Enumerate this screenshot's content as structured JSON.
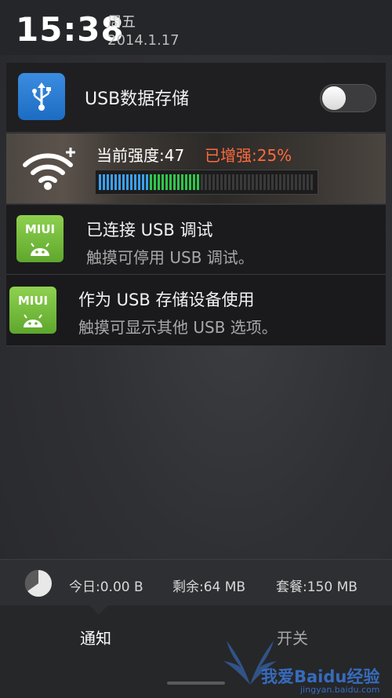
{
  "status": {
    "time": "15:38",
    "weekday": "周五",
    "date": "2014.1.17"
  },
  "usb_storage": {
    "label": "USB数据存储",
    "icon": "usb-icon",
    "toggle_on": false
  },
  "wifi_boost": {
    "strength_label": "当前强度:47",
    "boost_label": "已增强:25%",
    "strength_value": 47,
    "boost_percent": 25,
    "colors": {
      "blue": "#3aa0f0",
      "green": "#2fc64a",
      "boost": "#ff6a3d"
    }
  },
  "notifications": [
    {
      "icon_text": "MIUI",
      "title": "已连接 USB 调试",
      "subtitle": "触摸可停用 USB 调试。"
    },
    {
      "icon_text": "MIUI",
      "title": "作为 USB 存储设备使用",
      "subtitle": "触摸可显示其他 USB 选项。"
    }
  ],
  "traffic": {
    "today": "今日:0.00 B",
    "remaining": "剩余:64 MB",
    "plan": "套餐:150 MB"
  },
  "tabs": {
    "notify": "通知",
    "switch": "开关"
  },
  "watermark": {
    "text": "我爱Baidu经验",
    "url": "jingyan.baidu.com"
  }
}
